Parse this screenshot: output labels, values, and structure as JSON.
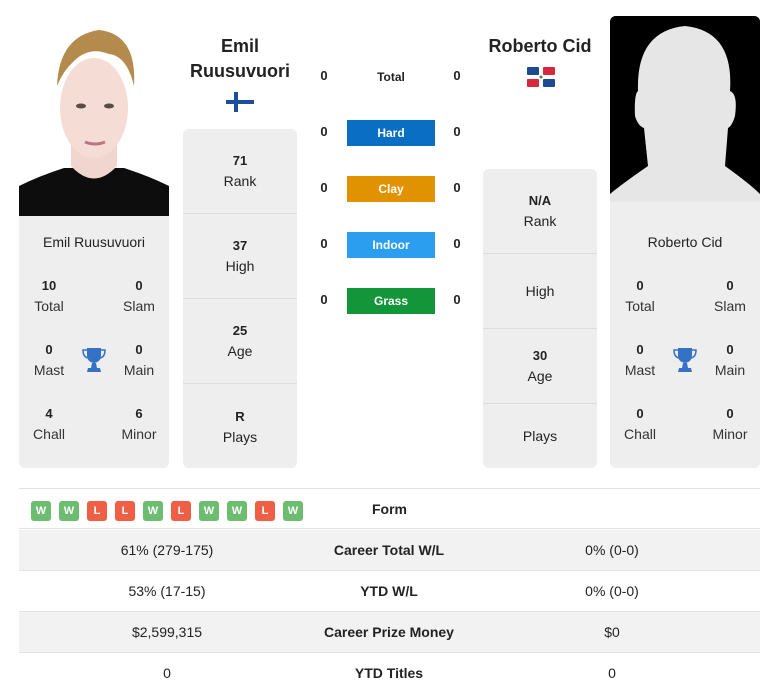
{
  "player1": {
    "name_line1": "Emil",
    "name_line2": "Ruusuvuori",
    "card_name": "Emil Ruusuvuori",
    "country_flag": "finland-flag",
    "titles": {
      "total": {
        "value": "10",
        "label": "Total"
      },
      "slam": {
        "value": "0",
        "label": "Slam"
      },
      "mast": {
        "value": "0",
        "label": "Mast"
      },
      "main": {
        "value": "0",
        "label": "Main"
      },
      "chall": {
        "value": "4",
        "label": "Chall"
      },
      "minor": {
        "value": "6",
        "label": "Minor"
      }
    },
    "info": [
      {
        "value": "71",
        "label": "Rank"
      },
      {
        "value": "37",
        "label": "High"
      },
      {
        "value": "25",
        "label": "Age"
      },
      {
        "value": "R",
        "label": "Plays"
      }
    ]
  },
  "player2": {
    "name": "Roberto Cid",
    "card_name": "Roberto Cid",
    "country_flag": "dominican-republic-flag",
    "titles": {
      "total": {
        "value": "0",
        "label": "Total"
      },
      "slam": {
        "value": "0",
        "label": "Slam"
      },
      "mast": {
        "value": "0",
        "label": "Mast"
      },
      "main": {
        "value": "0",
        "label": "Main"
      },
      "chall": {
        "value": "0",
        "label": "Chall"
      },
      "minor": {
        "value": "0",
        "label": "Minor"
      }
    },
    "info": [
      {
        "value": "N/A",
        "label": "Rank"
      },
      {
        "value": "",
        "label": "High"
      },
      {
        "value": "30",
        "label": "Age"
      },
      {
        "value": "",
        "label": "Plays"
      }
    ]
  },
  "h2h": [
    {
      "label": "Total",
      "left": "0",
      "right": "0",
      "color": ""
    },
    {
      "label": "Hard",
      "left": "0",
      "right": "0",
      "color": "#0a6fc2"
    },
    {
      "label": "Clay",
      "left": "0",
      "right": "0",
      "color": "#e09200"
    },
    {
      "label": "Indoor",
      "left": "0",
      "right": "0",
      "color": "#2b9ef0"
    },
    {
      "label": "Grass",
      "left": "0",
      "right": "0",
      "color": "#13953a"
    }
  ],
  "form": {
    "label": "Form",
    "results": [
      "W",
      "W",
      "L",
      "L",
      "W",
      "L",
      "W",
      "W",
      "L",
      "W"
    ]
  },
  "comparison": [
    {
      "left": "61% (279-175)",
      "label": "Career Total W/L",
      "right": "0% (0-0)"
    },
    {
      "left": "53% (17-15)",
      "label": "YTD W/L",
      "right": "0% (0-0)"
    },
    {
      "left": "$2,599,315",
      "label": "Career Prize Money",
      "right": "$0"
    },
    {
      "left": "0",
      "label": "YTD Titles",
      "right": "0"
    }
  ]
}
